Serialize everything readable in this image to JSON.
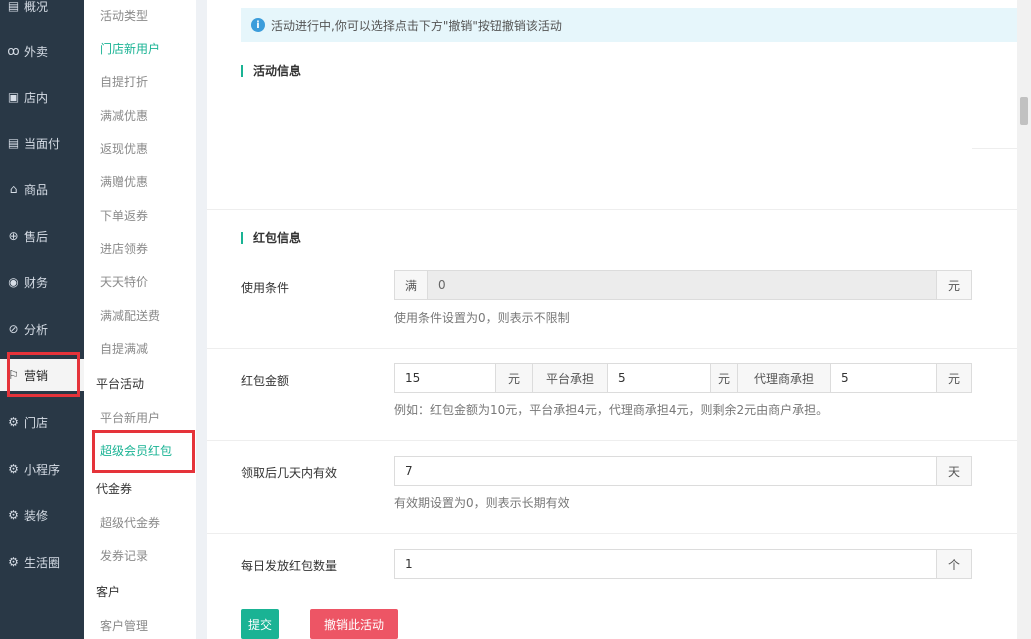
{
  "nav": {
    "items": [
      {
        "label": "概况",
        "icon": "overview-icon",
        "glyph": "▤"
      },
      {
        "label": "外卖",
        "icon": "delivery-icon",
        "glyph": "ꝏ"
      },
      {
        "label": "店内",
        "icon": "store-icon",
        "glyph": "▣"
      },
      {
        "label": "当面付",
        "icon": "pay-icon",
        "glyph": "▤"
      },
      {
        "label": "商品",
        "icon": "goods-icon",
        "glyph": "⌂"
      },
      {
        "label": "售后",
        "icon": "after-sales-icon",
        "glyph": "⊕"
      },
      {
        "label": "财务",
        "icon": "finance-icon",
        "glyph": "◉"
      },
      {
        "label": "分析",
        "icon": "analysis-icon",
        "glyph": "⊘"
      },
      {
        "label": "营销",
        "icon": "marketing-icon",
        "glyph": "⚐"
      },
      {
        "label": "门店",
        "icon": "shop-gear-icon",
        "glyph": "⚙"
      },
      {
        "label": "小程序",
        "icon": "miniapp-gear-icon",
        "glyph": "⚙"
      },
      {
        "label": "装修",
        "icon": "decor-gear-icon",
        "glyph": "⚙"
      },
      {
        "label": "生活圈",
        "icon": "life-circle-gear-icon",
        "glyph": "⚙"
      }
    ]
  },
  "submenu": {
    "items": [
      {
        "label": "活动类型",
        "kind": "item"
      },
      {
        "label": "门店新用户",
        "kind": "hl"
      },
      {
        "label": "自提打折",
        "kind": "item"
      },
      {
        "label": "满减优惠",
        "kind": "item"
      },
      {
        "label": "返现优惠",
        "kind": "item"
      },
      {
        "label": "满赠优惠",
        "kind": "item"
      },
      {
        "label": "下单返券",
        "kind": "item"
      },
      {
        "label": "进店领券",
        "kind": "item"
      },
      {
        "label": "天天特价",
        "kind": "item"
      },
      {
        "label": "满减配送费",
        "kind": "item"
      },
      {
        "label": "自提满减",
        "kind": "item"
      },
      {
        "label": "平台活动",
        "kind": "group"
      },
      {
        "label": "平台新用户",
        "kind": "item"
      },
      {
        "label": "超级会员红包",
        "kind": "hl"
      },
      {
        "label": "代金券",
        "kind": "group"
      },
      {
        "label": "超级代金券",
        "kind": "item"
      },
      {
        "label": "发券记录",
        "kind": "item"
      },
      {
        "label": "客户",
        "kind": "group"
      },
      {
        "label": "客户管理",
        "kind": "item"
      }
    ]
  },
  "notice": {
    "text": "活动进行中,你可以选择点击下方\"撤销\"按钮撤销该活动"
  },
  "sections": {
    "activity_info": "活动信息",
    "redpacket_info": "红包信息"
  },
  "form": {
    "condition": {
      "label": "使用条件",
      "prefix": "满",
      "value": "0",
      "unit": "元",
      "hint": "使用条件设置为0，则表示不限制"
    },
    "amount": {
      "label": "红包金额",
      "value": "15",
      "unit": "元",
      "platform_label": "平台承担",
      "platform_value": "5",
      "platform_unit": "元",
      "agent_label": "代理商承担",
      "agent_value": "5",
      "agent_unit": "元",
      "hint": "例如：红包金额为10元，平台承担4元，代理商承担4元，则剩余2元由商户承担。"
    },
    "valid_days": {
      "label": "领取后几天内有效",
      "value": "7",
      "unit": "天",
      "hint": "有效期设置为0，则表示长期有效"
    },
    "daily_count": {
      "label": "每日发放红包数量",
      "value": "1",
      "unit": "个"
    }
  },
  "buttons": {
    "submit": "提交",
    "cancel": "撤销此活动"
  },
  "colors": {
    "accent": "#1ab394",
    "danger": "#ed5565",
    "nav_bg": "#293846",
    "highlight_box": "#e5333a"
  }
}
